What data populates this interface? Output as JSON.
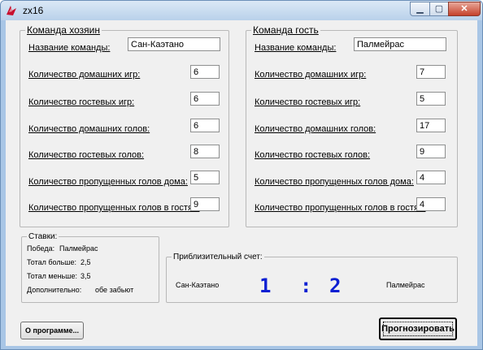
{
  "window": {
    "title": "zx16"
  },
  "home": {
    "legend": "Команда хозяин",
    "fields": [
      {
        "label": "Название команды:",
        "value": "Сан-Каэтано"
      },
      {
        "label": "Количество домашних игр:",
        "value": "6"
      },
      {
        "label": "Количество гостевых игр:",
        "value": "6"
      },
      {
        "label": "Количество домашних голов:",
        "value": "6"
      },
      {
        "label": "Количество гостевых голов:",
        "value": "8"
      },
      {
        "label": "Количество пропущенных голов дома:",
        "value": "5"
      },
      {
        "label": "Количество пропущенных голов в гостях:",
        "value": "9"
      }
    ]
  },
  "guest": {
    "legend": "Команда гость",
    "fields": [
      {
        "label": "Название команды:",
        "value": "Палмейрас"
      },
      {
        "label": "Количество домашних игр:",
        "value": "7"
      },
      {
        "label": "Количество гостевых игр:",
        "value": "5"
      },
      {
        "label": "Количество домашних голов:",
        "value": "17"
      },
      {
        "label": "Количество гостевых голов:",
        "value": "9"
      },
      {
        "label": "Количество пропущенных голов дома:",
        "value": "4"
      },
      {
        "label": "Количество пропущенных голов в гостях:",
        "value": "4"
      }
    ]
  },
  "bets": {
    "legend": "Ставки:",
    "victory_label": "Победа:",
    "victory_value": "Палмейрас",
    "over_label": "Тотал больше:",
    "over_value": "2,5",
    "under_label": "Тотал меньше:",
    "under_value": "3,5",
    "extra_label": "Дополнительно:",
    "extra_value": "обе забьют"
  },
  "score": {
    "legend": "Приблизительный счет:",
    "home_team": "Сан-Каэтано",
    "home_goals": "1",
    "separator": ":",
    "away_goals": "2",
    "away_team": "Палмейрас",
    "color": "#0b1fd2"
  },
  "buttons": {
    "about": "О программе...",
    "predict": "Прогнозировать"
  },
  "colors": {
    "window_frame": "#a9c6e6",
    "client_bg": "#f0f0f0",
    "close_button": "#c5412a"
  },
  "icons": {
    "app": "red-bird-icon",
    "minimize": "minimize-icon",
    "maximize": "maximize-icon",
    "close": "close-icon"
  }
}
